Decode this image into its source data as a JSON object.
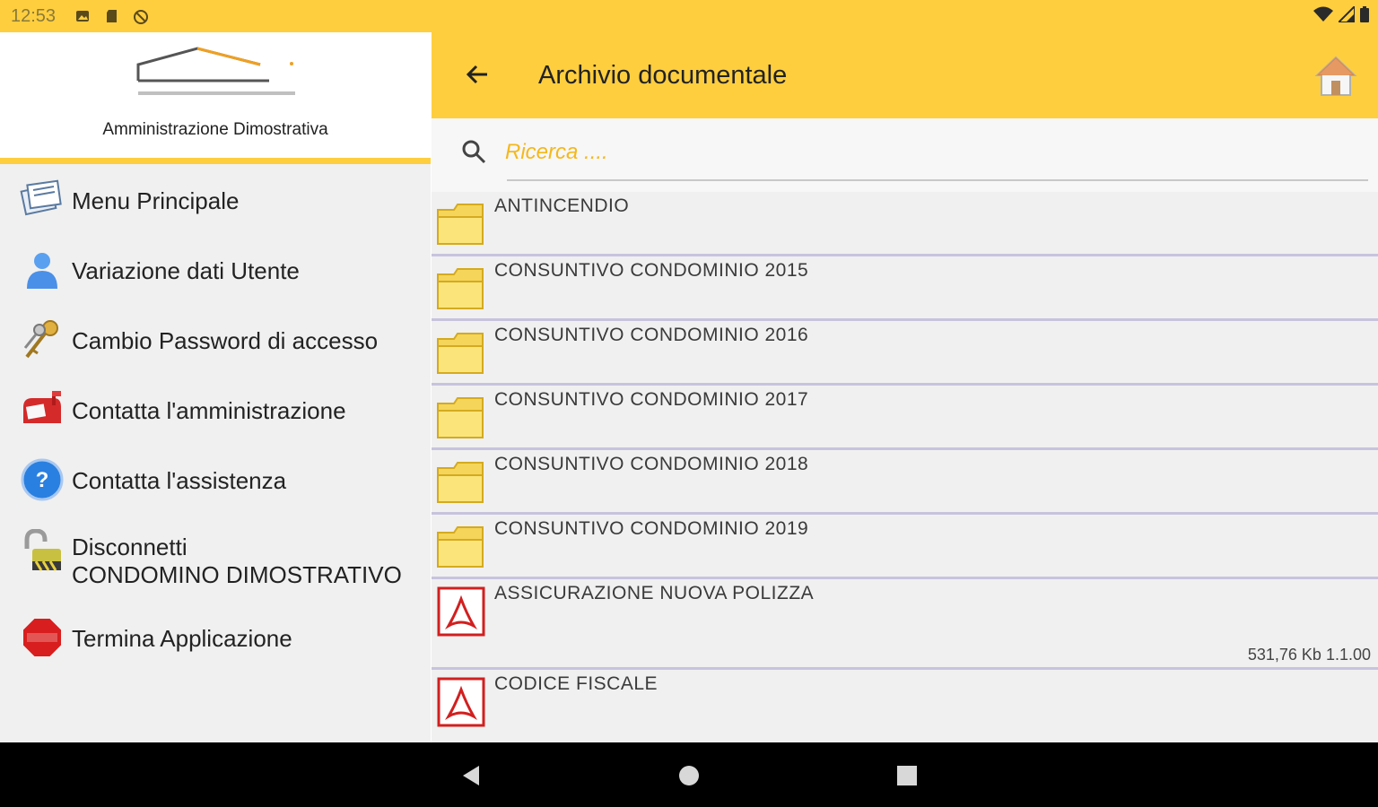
{
  "status": {
    "time": "12:53",
    "left_icons": [
      "image-icon",
      "sd-card-icon",
      "no-location-icon"
    ],
    "right_icons": [
      "wifi-icon",
      "signal-icon",
      "battery-icon"
    ]
  },
  "drawer": {
    "organization": "Amministrazione Dimostrativa",
    "items": [
      {
        "label": "Menu Principale",
        "icon": "documents-icon"
      },
      {
        "label": "Variazione dati Utente",
        "icon": "user-icon"
      },
      {
        "label": "Cambio Password di accesso",
        "icon": "keys-icon"
      },
      {
        "label": "Contatta l'amministrazione",
        "icon": "mailbox-icon"
      },
      {
        "label": "Contatta l'assistenza",
        "icon": "help-icon"
      },
      {
        "label_line1": "Disconnetti",
        "label_line2": "CONDOMINO DIMOSTRATIVO",
        "icon": "padlock-icon"
      },
      {
        "label": "Termina Applicazione",
        "icon": "stop-icon"
      }
    ]
  },
  "appbar": {
    "title": "Archivio documentale",
    "back_icon": "arrow-back-icon",
    "home_icon": "home-icon"
  },
  "search": {
    "placeholder": "Ricerca ...."
  },
  "documents": [
    {
      "name": "ANTINCENDIO",
      "type": "folder"
    },
    {
      "name": "CONSUNTIVO CONDOMINIO 2015",
      "type": "folder"
    },
    {
      "name": "CONSUNTIVO CONDOMINIO 2016",
      "type": "folder"
    },
    {
      "name": "CONSUNTIVO CONDOMINIO 2017",
      "type": "folder"
    },
    {
      "name": "CONSUNTIVO CONDOMINIO 2018",
      "type": "folder"
    },
    {
      "name": "CONSUNTIVO CONDOMINIO 2019",
      "type": "folder"
    },
    {
      "name": "ASSICURAZIONE NUOVA POLIZZA",
      "type": "pdf",
      "meta": "531,76 Kb 1.1.00"
    },
    {
      "name": "CODICE FISCALE",
      "type": "pdf"
    }
  ],
  "colors": {
    "accent": "#fece3f",
    "placeholder": "#f5b81b",
    "separator": "#c7c3de",
    "drawer_bg": "#f0f0f0"
  }
}
